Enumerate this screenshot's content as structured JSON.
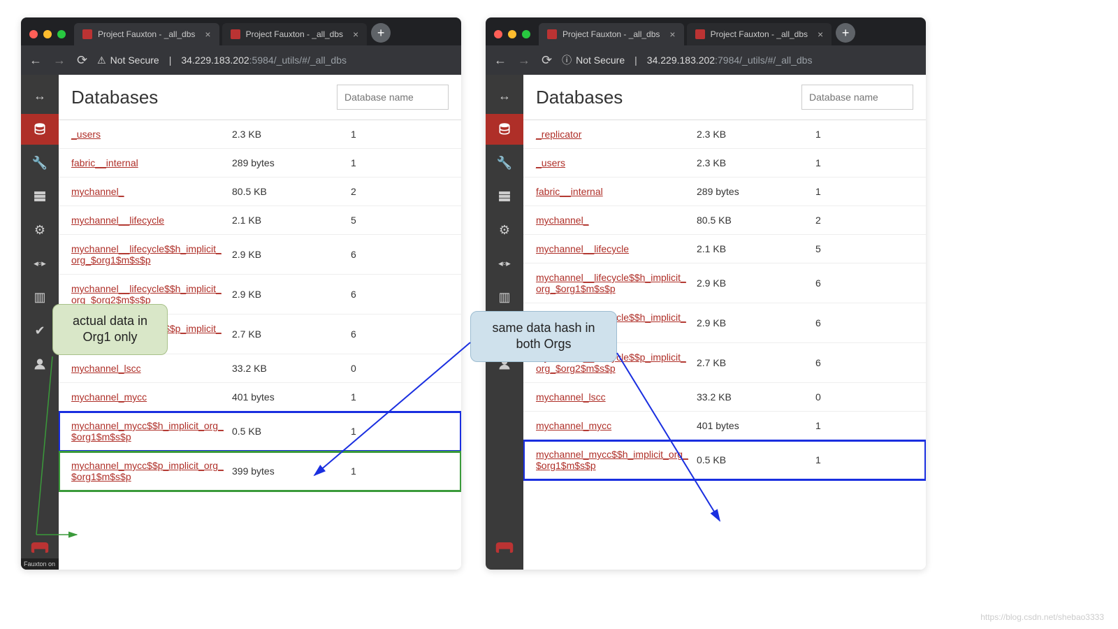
{
  "browser": {
    "tab_title": "Project Fauxton - _all_dbs",
    "new_tab_label": "+",
    "close_label": "×",
    "back": "←",
    "forward": "→",
    "reload": "⟳",
    "not_secure": "Not Secure",
    "host": "34.229.183.202"
  },
  "left": {
    "port": ":5984",
    "path": "/_utils/#/_all_dbs",
    "page_title": "Databases",
    "search_placeholder": "Database name",
    "status_text": "Fauxton on",
    "rows": [
      {
        "name": "_users",
        "size": "2.3 KB",
        "docs": "1",
        "hl": ""
      },
      {
        "name": "fabric__internal",
        "size": "289 bytes",
        "docs": "1",
        "hl": ""
      },
      {
        "name": "mychannel_",
        "size": "80.5 KB",
        "docs": "2",
        "hl": ""
      },
      {
        "name": "mychannel__lifecycle",
        "size": "2.1 KB",
        "docs": "5",
        "hl": ""
      },
      {
        "name": "mychannel__lifecycle$$h_implicit_org_$org1$m$s$p",
        "size": "2.9 KB",
        "docs": "6",
        "hl": ""
      },
      {
        "name": "mychannel__lifecycle$$h_implicit_org_$org2$m$s$p",
        "size": "2.9 KB",
        "docs": "6",
        "hl": ""
      },
      {
        "name": "mychannel__lifecycle$$p_implicit_org_$org1$m$s$p",
        "size": "2.7 KB",
        "docs": "6",
        "hl": ""
      },
      {
        "name": "mychannel_lscc",
        "size": "33.2 KB",
        "docs": "0",
        "hl": ""
      },
      {
        "name": "mychannel_mycc",
        "size": "401 bytes",
        "docs": "1",
        "hl": ""
      },
      {
        "name": "mychannel_mycc$$h_implicit_org_$org1$m$s$p",
        "size": "0.5 KB",
        "docs": "1",
        "hl": "blue"
      },
      {
        "name": "mychannel_mycc$$p_implicit_org_$org1$m$s$p",
        "size": "399 bytes",
        "docs": "1",
        "hl": "green"
      }
    ]
  },
  "right": {
    "port": ":7984",
    "path": "/_utils/#/_all_dbs",
    "page_title": "Databases",
    "search_placeholder": "Database name",
    "rows": [
      {
        "name": "_replicator",
        "size": "2.3 KB",
        "docs": "1",
        "hl": ""
      },
      {
        "name": "_users",
        "size": "2.3 KB",
        "docs": "1",
        "hl": ""
      },
      {
        "name": "fabric__internal",
        "size": "289 bytes",
        "docs": "1",
        "hl": ""
      },
      {
        "name": "mychannel_",
        "size": "80.5 KB",
        "docs": "2",
        "hl": ""
      },
      {
        "name": "mychannel__lifecycle",
        "size": "2.1 KB",
        "docs": "5",
        "hl": ""
      },
      {
        "name": "mychannel__lifecycle$$h_implicit_org_$org1$m$s$p",
        "size": "2.9 KB",
        "docs": "6",
        "hl": ""
      },
      {
        "name": "mychannel__lifecycle$$h_implicit_org_$org2$m$s$p",
        "size": "2.9 KB",
        "docs": "6",
        "hl": ""
      },
      {
        "name": "mychannel__lifecycle$$p_implicit_org_$org2$m$s$p",
        "size": "2.7 KB",
        "docs": "6",
        "hl": ""
      },
      {
        "name": "mychannel_lscc",
        "size": "33.2 KB",
        "docs": "0",
        "hl": ""
      },
      {
        "name": "mychannel_mycc",
        "size": "401 bytes",
        "docs": "1",
        "hl": ""
      },
      {
        "name": "mychannel_mycc$$h_implicit_org_$org1$m$s$p",
        "size": "0.5 KB",
        "docs": "1",
        "hl": "blue"
      }
    ]
  },
  "callouts": {
    "green": "actual data in Org1 only",
    "blue": "same data hash in both Orgs"
  },
  "watermark": "https://blog.csdn.net/shebao3333"
}
